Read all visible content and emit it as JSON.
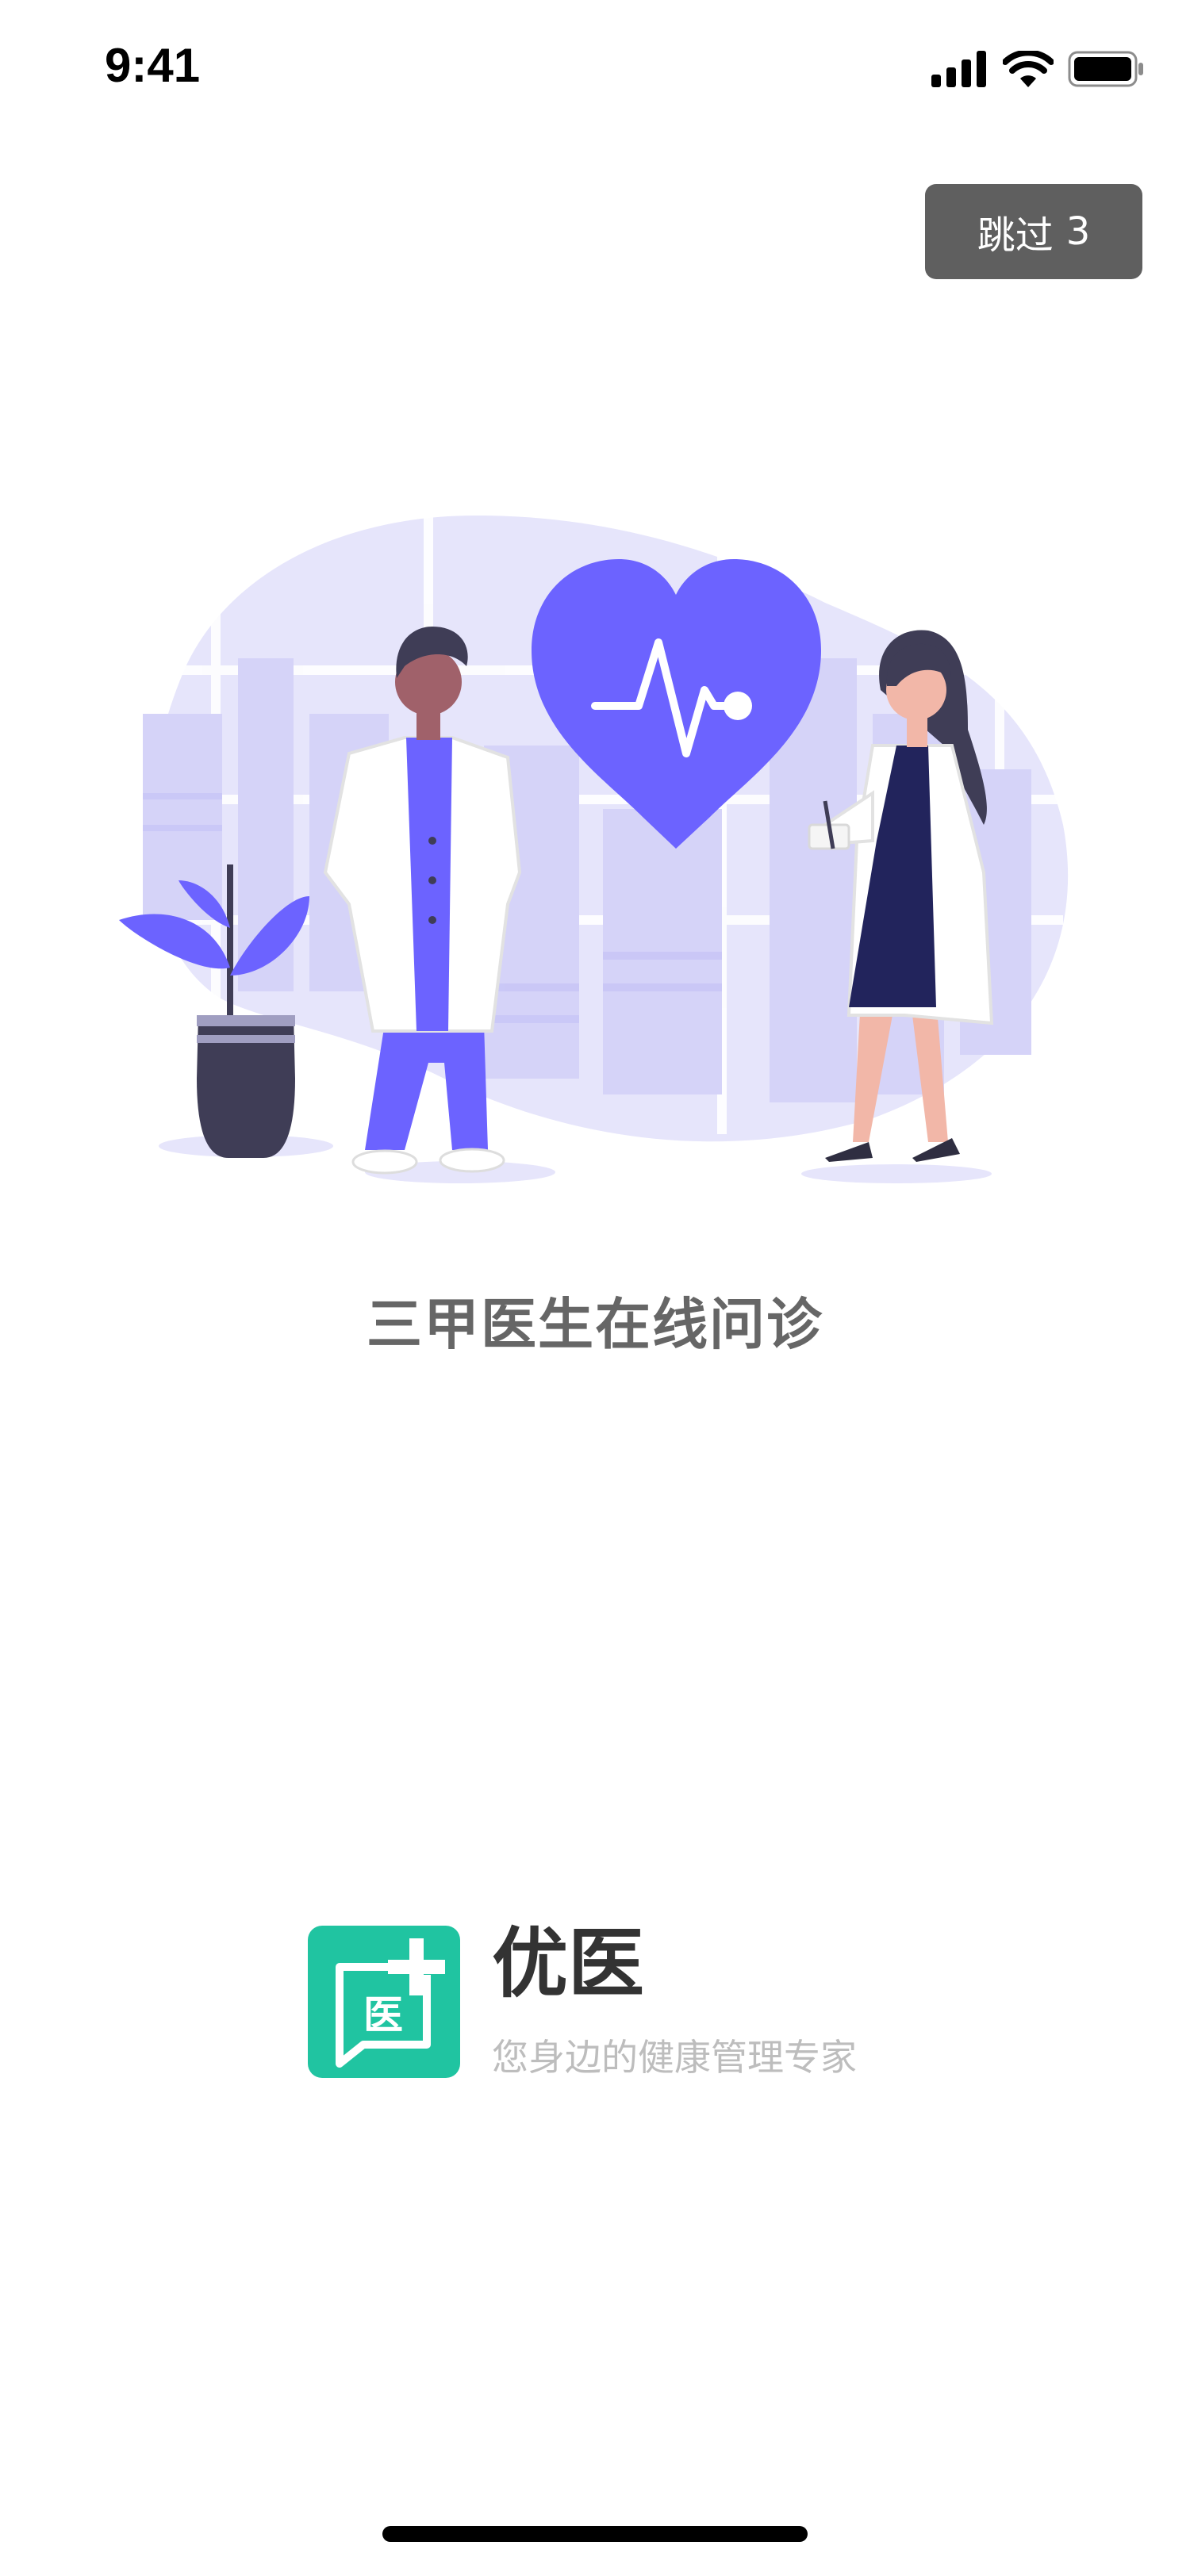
{
  "status_bar": {
    "time": "9:41",
    "icons": [
      "signal-icon",
      "wifi-icon",
      "battery-icon"
    ]
  },
  "skip": {
    "label": "跳过",
    "countdown": "3"
  },
  "illustration": {
    "icon": "doctors-heart-illustration",
    "colors": {
      "accent": "#6c63ff",
      "light": "#e6e5fb",
      "dark": "#3f3d56"
    }
  },
  "tagline": "三甲医生在线问诊",
  "brand": {
    "logo_text": "医",
    "name": "优医",
    "slogan": "您身边的健康管理专家",
    "color": "#20c4a1"
  }
}
